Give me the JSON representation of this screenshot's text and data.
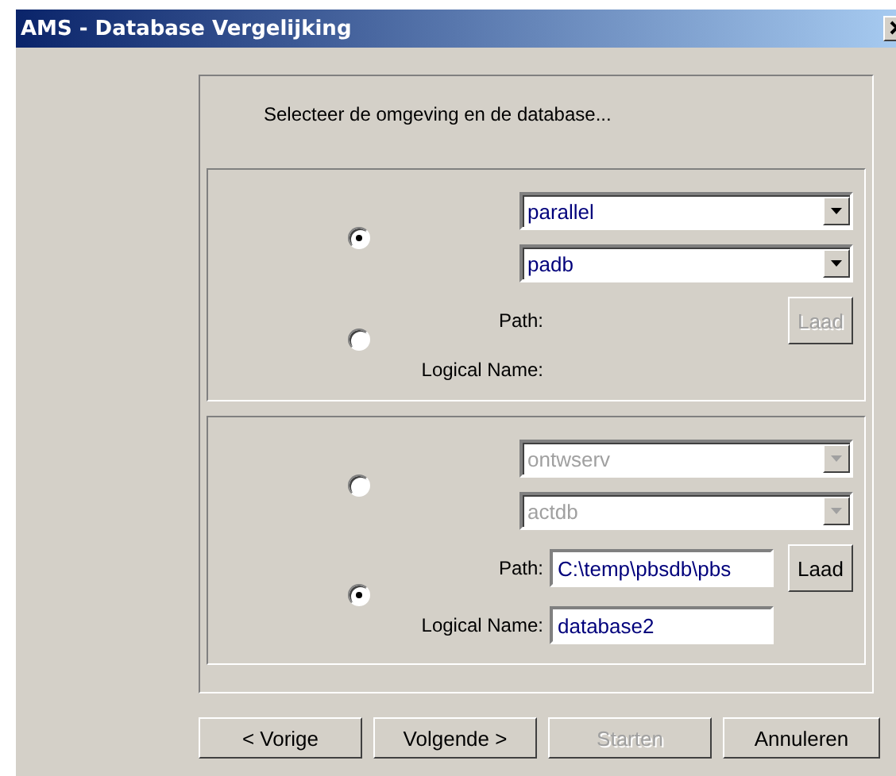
{
  "window": {
    "title": "AMS - Database Vergelijking"
  },
  "instruction": "Selecteer de omgeving en de database...",
  "groups": [
    {
      "env_radio_selected": true,
      "combos": [
        {
          "value": "parallel",
          "disabled": false
        },
        {
          "value": "padb",
          "disabled": false
        }
      ],
      "path_radio_selected": false,
      "path_label": "Path:",
      "logical_label": "Logical Name:",
      "load_button": {
        "label": "Laad",
        "disabled": true
      }
    },
    {
      "env_radio_selected": false,
      "combos": [
        {
          "value": "ontwserv",
          "disabled": true
        },
        {
          "value": "actdb",
          "disabled": true
        }
      ],
      "path_radio_selected": true,
      "path_label": "Path:",
      "path_value": "C:\\temp\\pbsdb\\pbs",
      "logical_label": "Logical Name:",
      "logical_value": "database2",
      "load_button": {
        "label": "Laad",
        "disabled": false
      }
    }
  ],
  "buttons": [
    {
      "label": "< Vorige",
      "disabled": false
    },
    {
      "label": "Volgende >",
      "disabled": false
    },
    {
      "label": "Starten",
      "disabled": true
    },
    {
      "label": "Annuleren",
      "disabled": false
    }
  ]
}
